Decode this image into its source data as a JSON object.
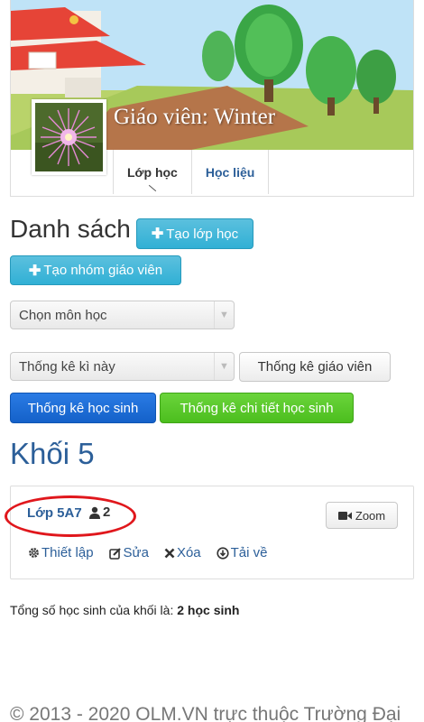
{
  "profile": {
    "cover_title": "Giáo viên: Winter",
    "tabs": [
      {
        "label": "Lớp học",
        "active": true
      },
      {
        "label": "Học liệu",
        "active": false
      }
    ]
  },
  "main": {
    "list_title": "Danh sách",
    "create_class_label": "Tạo lớp học",
    "create_teacher_group_label": "Tạo nhóm giáo viên",
    "subject_select": {
      "value": "Chọn môn học"
    },
    "period_select": {
      "value": "Thống kê kì này"
    },
    "teacher_stats_label": "Thống kê giáo viên",
    "student_stats_label": "Thống kê học sinh",
    "student_detail_stats_label": "Thống kê chi tiết học sinh",
    "grade_title": "Khối 5"
  },
  "class_card": {
    "class_name": "Lớp 5A7",
    "student_count": "2",
    "zoom_label": "Zoom",
    "actions": [
      {
        "label": "Thiết lập",
        "icon": "gear-icon"
      },
      {
        "label": "Sửa",
        "icon": "edit-icon"
      },
      {
        "label": "Xóa",
        "icon": "remove-icon"
      },
      {
        "label": "Tải về",
        "icon": "download-icon"
      }
    ]
  },
  "summary": {
    "prefix": "Tổng số học sinh của khối là:",
    "value": "2 học sinh"
  },
  "footer": {
    "text": "© 2013 - 2020 OLM.VN trực thuộc Trường Đại"
  },
  "colors": {
    "link": "#2c5f99",
    "info_button": "#31b0d5",
    "primary_button": "#1461c9",
    "success_button": "#4cbe1e",
    "annotation_circle": "#e0171c"
  }
}
